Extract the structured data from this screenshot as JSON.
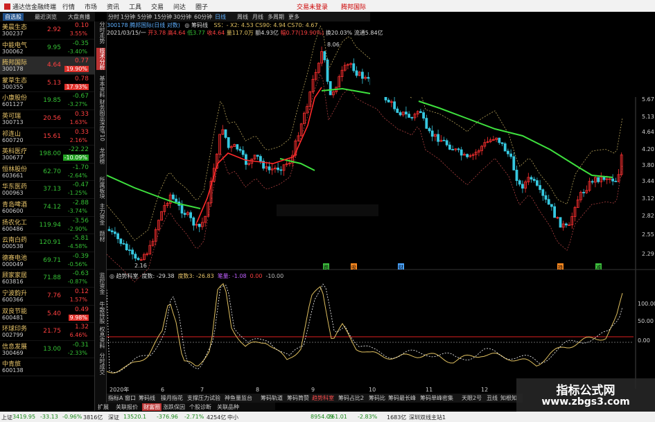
{
  "titlebar": {
    "app": "通达信金融终端",
    "menus": [
      "行情",
      "市场",
      "资讯",
      "工具",
      "交易",
      "问达",
      "圈子"
    ],
    "right_links": [
      "交易未登录",
      "腾邦国际"
    ]
  },
  "left_tabs": [
    "自选股",
    "最近浏览",
    "大盘直播"
  ],
  "stocks": [
    {
      "name": "美晨生态",
      "code": "300237",
      "price": "2.92",
      "change": "0.10",
      "pct": "3.55%",
      "dir": "up",
      "hl": false
    },
    {
      "name": "中能电气",
      "code": "300062",
      "price": "9.95",
      "change": "-0.35",
      "pct": "-3.40%",
      "dir": "dn",
      "hl": false
    },
    {
      "name": "腾邦国际",
      "code": "300178",
      "price": "4.64",
      "change": "0.77",
      "pct": "19.90%",
      "dir": "up",
      "hl": true,
      "sel": true
    },
    {
      "name": "蒙草生态",
      "code": "300355",
      "price": "5.13",
      "change": "0.78",
      "pct": "17.93%",
      "dir": "up",
      "hl": true
    },
    {
      "name": "小康股份",
      "code": "601127",
      "price": "19.85",
      "change": "-0.67",
      "pct": "-3.27%",
      "dir": "dn",
      "hl": false
    },
    {
      "name": "英可瑞",
      "code": "300713",
      "price": "20.56",
      "change": "0.33",
      "pct": "1.63%",
      "dir": "up",
      "hl": false
    },
    {
      "name": "祁连山",
      "code": "600720",
      "price": "15.61",
      "change": "0.33",
      "pct": "2.16%",
      "dir": "up",
      "hl": false
    },
    {
      "name": "英科医疗",
      "code": "300677",
      "price": "198.00",
      "change": "-22.22",
      "pct": "-10.09%",
      "dir": "dn",
      "hl": true
    },
    {
      "name": "恒林股份",
      "code": "603661",
      "price": "62.70",
      "change": "-1.70",
      "pct": "-2.64%",
      "dir": "dn",
      "hl": false
    },
    {
      "name": "华东医药",
      "code": "000963",
      "price": "37.13",
      "change": "-0.47",
      "pct": "-1.25%",
      "dir": "dn",
      "hl": false
    },
    {
      "name": "青岛啤酒",
      "code": "600600",
      "price": "74.12",
      "change": "-2.88",
      "pct": "-3.74%",
      "dir": "dn",
      "hl": false
    },
    {
      "name": "扬农化工",
      "code": "600486",
      "price": "119.94",
      "change": "-3.56",
      "pct": "-2.90%",
      "dir": "dn",
      "hl": false
    },
    {
      "name": "云南白药",
      "code": "000538",
      "price": "120.91",
      "change": "-5.81",
      "pct": "-4.58%",
      "dir": "dn",
      "hl": false
    },
    {
      "name": "德赛电池",
      "code": "000049",
      "price": "69.71",
      "change": "-0.39",
      "pct": "-0.56%",
      "dir": "dn",
      "hl": false
    },
    {
      "name": "顾家家居",
      "code": "603816",
      "price": "71.88",
      "change": "-0.63",
      "pct": "-0.87%",
      "dir": "dn",
      "hl": false
    },
    {
      "name": "宁波韵升",
      "code": "600366",
      "price": "7.76",
      "change": "0.12",
      "pct": "1.57%",
      "dir": "up",
      "hl": false
    },
    {
      "name": "双良节能",
      "code": "600481",
      "price": "5.40",
      "change": "0.49",
      "pct": "9.98%",
      "dir": "up",
      "hl": true
    },
    {
      "name": "环球印务",
      "code": "002799",
      "price": "21.75",
      "change": "1.32",
      "pct": "6.46%",
      "dir": "up",
      "hl": false
    },
    {
      "name": "信息发展",
      "code": "300469",
      "price": "13.00",
      "change": "-0.31",
      "pct": "-2.33%",
      "dir": "dn",
      "hl": false
    },
    {
      "name": "中青旅",
      "code": "600138",
      "price": "",
      "change": "",
      "pct": "",
      "dir": "dn",
      "hl": false
    }
  ],
  "vtabs": [
    "分时走势",
    "技术分析",
    "基本资料",
    "财务图示",
    "深度F10",
    "龙虎榜",
    "所属板块",
    "主力资金",
    "题材"
  ],
  "vtabs_lower": [
    "监控资金",
    "牛散持股",
    "权息资料",
    "分时成交"
  ],
  "toptool": [
    "分时",
    "1分钟",
    "5分钟",
    "15分钟",
    "30分钟",
    "60分钟",
    "日线",
    "周线",
    "月线",
    "多周期",
    "更多"
  ],
  "toptool_active": "日线",
  "info1": {
    "stock": "300178 腾邦国际(日线 对数)",
    "ind": "◎ 筹码线",
    "ma": "SS：-  X2: 4.53  CS90: 4.94  CS70: 4.67"
  },
  "info2": {
    "date": "2021/03/15/一",
    "open": "开3.78",
    "high": "高4.64",
    "low": "低3.77",
    "close": "收4.64",
    "vol": "量117.0万",
    "amt": "额4.93亿",
    "chg": "幅0.77(19.90%)",
    "turn": "换20.03%",
    "circ": "流通5.84亿"
  },
  "price_axis": [
    "5.67",
    "5.13",
    "4.64",
    "4.20",
    "3.80",
    "3.44",
    "3.12",
    "2.82",
    "2.55",
    "2.29"
  ],
  "hi_label": "8.06",
  "lo_label": "2.16",
  "signals": [
    {
      "t": "踢",
      "c": "#3ec23e"
    },
    {
      "t": "吸",
      "c": "#ff8a20"
    },
    {
      "t": "财",
      "c": "#4aa3ff"
    },
    {
      "t": "持",
      "c": "#ff8a20"
    },
    {
      "t": "减",
      "c": "#3ec23e"
    }
  ],
  "lower_info": {
    "name": "◎ 趋势科室",
    "vals": [
      {
        "t": "度数: -29.38",
        "c": "#ddd"
      },
      {
        "t": "度数3: -26.83",
        "c": "#e8c56a"
      },
      {
        "t": "笔量: -1.08",
        "c": "#c060ff"
      },
      {
        "t": "0.00",
        "c": "#ff4040"
      },
      {
        "t": "-10.00",
        "c": "#bbb"
      }
    ]
  },
  "lower_axis": [
    "100.00",
    "50.00",
    "0.00"
  ],
  "date_axis": [
    "2020年",
    "6",
    "7",
    "8",
    "9",
    "10",
    "11",
    "12"
  ],
  "bottom_tabs": [
    "指标A",
    "窗口",
    "筹码线",
    "操月指花",
    "支撑压力试验",
    "神鱼量监台",
    "筹码轨道",
    "筹码筒赞",
    "趋势科室",
    "筹码占比2",
    "筹码比",
    "筹码最长峰",
    "筹码单峰密集",
    "天眼2号",
    "丑线",
    "知根知"
  ],
  "bottom_tab_active": "趋势科室",
  "bottom_tabs2": [
    "扩展",
    "关联报价",
    "财富圈",
    "涨跌保因",
    "个股诊断",
    "关联品种"
  ],
  "bottom_tab2_active": "财富圈",
  "status": [
    {
      "t": "上证",
      "c": "#222"
    },
    {
      "t": "3419.95",
      "c": "#1a8a1a"
    },
    {
      "t": "-33.13",
      "c": "#1a8a1a"
    },
    {
      "t": "-0.96%",
      "c": "#1a8a1a"
    },
    {
      "t": "3816亿",
      "c": "#222"
    },
    {
      "t": "深证",
      "c": "#222"
    },
    {
      "t": "13520.1",
      "c": "#1a8a1a"
    },
    {
      "t": "-376.96",
      "c": "#1a8a1a"
    },
    {
      "t": "-2.71%",
      "c": "#1a8a1a"
    },
    {
      "t": "4254亿",
      "c": "#222"
    },
    {
      "t": "中小",
      "c": "#222"
    },
    {
      "t": "8954.09",
      "c": "#1a8a1a"
    },
    {
      "t": "-261.01",
      "c": "#1a8a1a"
    },
    {
      "t": "-2.83%",
      "c": "#1a8a1a"
    },
    {
      "t": "1683亿",
      "c": "#222"
    },
    {
      "t": "深圳双线主站1",
      "c": "#222"
    }
  ],
  "watermark": {
    "line1": "指标公式网",
    "line2": "www.zbgs3.com"
  },
  "colors": {
    "up": "#ff4040",
    "down": "#35c035",
    "ma_green": "#3ee03e",
    "ma_red": "#ff2a2a",
    "band": "#b8a35a",
    "osc": "#e0c060"
  }
}
